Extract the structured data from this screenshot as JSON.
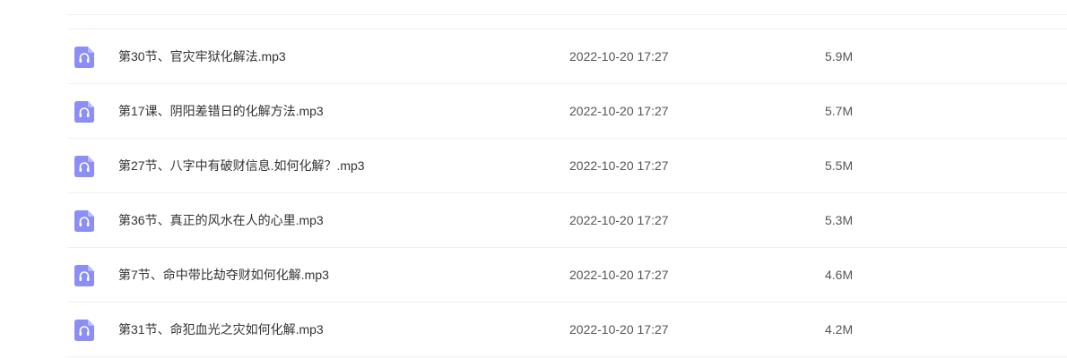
{
  "file_list": {
    "rows": [
      {
        "icon": "audio-file-icon",
        "name": "第30节、官灾牢狱化解法.mp3",
        "date": "2022-10-20 17:27",
        "size": "5.9M"
      },
      {
        "icon": "audio-file-icon",
        "name": "第17课、阴阳差错日的化解方法.mp3",
        "date": "2022-10-20 17:27",
        "size": "5.7M"
      },
      {
        "icon": "audio-file-icon",
        "name": "第27节、八字中有破财信息.如何化解？.mp3",
        "date": "2022-10-20 17:27",
        "size": "5.5M"
      },
      {
        "icon": "audio-file-icon",
        "name": "第36节、真正的风水在人的心里.mp3",
        "date": "2022-10-20 17:27",
        "size": "5.3M"
      },
      {
        "icon": "audio-file-icon",
        "name": "第7节、命中带比劫夺财如何化解.mp3",
        "date": "2022-10-20 17:27",
        "size": "4.6M"
      },
      {
        "icon": "audio-file-icon",
        "name": "第31节、命犯血光之灾如何化解.mp3",
        "date": "2022-10-20 17:27",
        "size": "4.2M"
      }
    ],
    "colors": {
      "icon_fill": "#8b8ef5",
      "icon_fold": "#b9bbfa",
      "divider": "#f0f0f0",
      "name_text": "#333333",
      "meta_text": "#555555"
    }
  }
}
